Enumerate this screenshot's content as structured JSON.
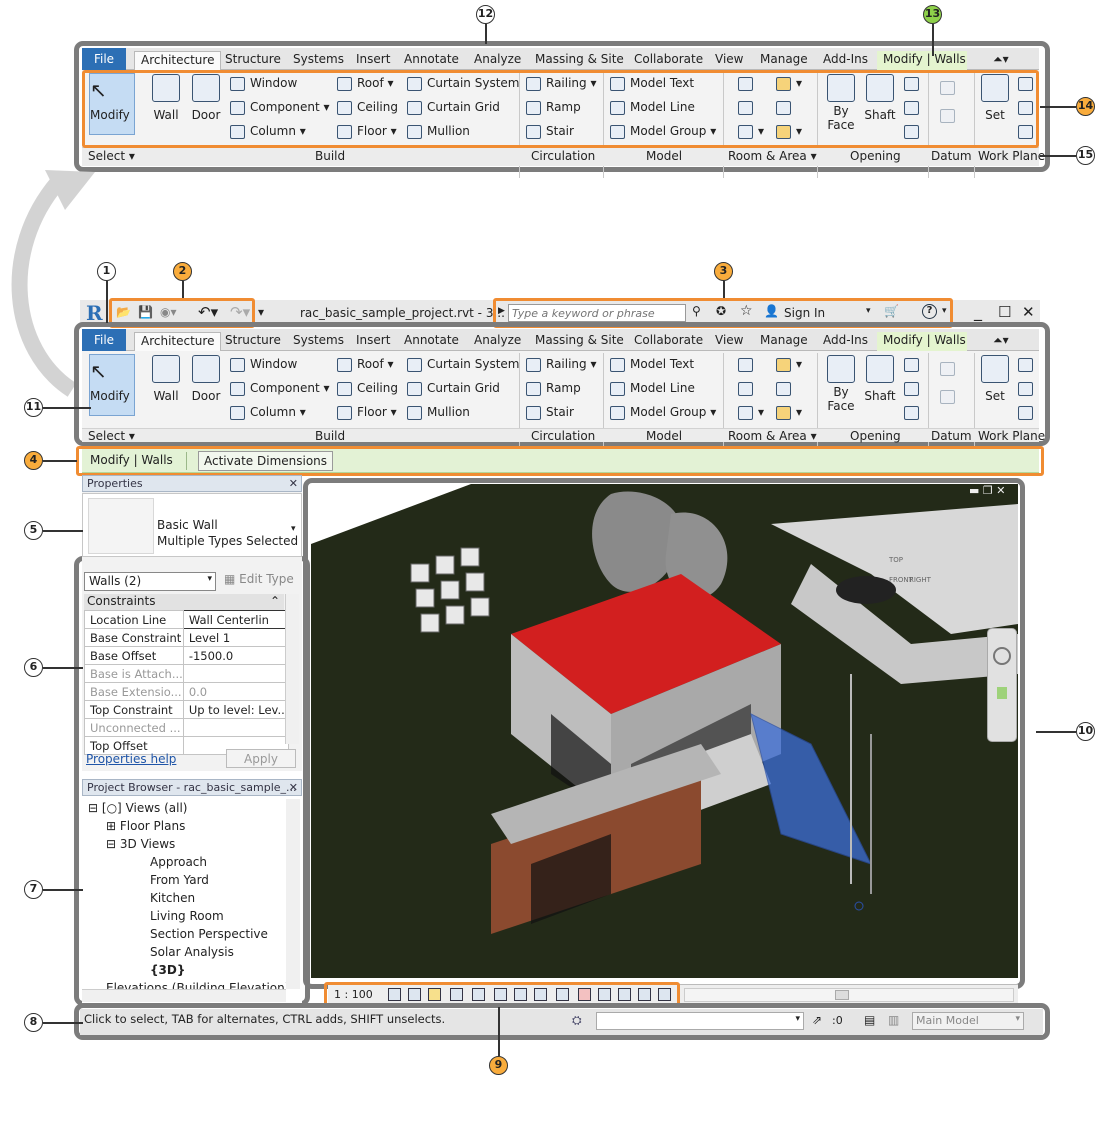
{
  "callouts": {
    "c1": "1",
    "c2": "2",
    "c3": "3",
    "c4": "4",
    "c5": "5",
    "c6": "6",
    "c7": "7",
    "c8": "8",
    "c9": "9",
    "c10": "10",
    "c11": "11",
    "c12": "12",
    "c13": "13",
    "c14": "14",
    "c15": "15"
  },
  "tabs": [
    "File",
    "Architecture",
    "Structure",
    "Systems",
    "Insert",
    "Annotate",
    "Analyze",
    "Massing & Site",
    "Collaborate",
    "View",
    "Manage",
    "Add-Ins",
    "Modify | Walls"
  ],
  "ribbon": {
    "modify": "Modify",
    "select": "Select",
    "wall": "Wall",
    "door": "Door",
    "window": "Window",
    "component": "Component",
    "column": "Column",
    "roof": "Roof",
    "ceiling": "Ceiling",
    "floor": "Floor",
    "curtain_system": "Curtain System",
    "curtain_grid": "Curtain Grid",
    "mullion": "Mullion",
    "railing": "Railing",
    "ramp": "Ramp",
    "stair": "Stair",
    "model_text": "Model Text",
    "model_line": "Model Line",
    "model_group": "Model Group",
    "by_face_1": "By",
    "by_face_2": "Face",
    "shaft": "Shaft",
    "set": "Set",
    "panels": {
      "build": "Build",
      "circulation": "Circulation",
      "model": "Model",
      "room_area": "Room & Area",
      "opening": "Opening",
      "datum": "Datum",
      "work_plane": "Work Plane"
    }
  },
  "titlebar": {
    "file": "rac_basic_sample_project.rvt - 3...",
    "search_placeholder": "Type a keyword or phrase",
    "sign_in": "Sign In"
  },
  "context_bar": {
    "label": "Modify | Walls",
    "button": "Activate Dimensions"
  },
  "properties": {
    "title": "Properties",
    "type_line1": "Basic Wall",
    "type_line2": "Multiple Types Selected",
    "selector": "Walls (2)",
    "edit_type": "Edit Type",
    "section": "Constraints",
    "rows": [
      [
        "Location Line",
        "Wall Centerlin"
      ],
      [
        "Base Constraint",
        "Level 1"
      ],
      [
        "Base Offset",
        "-1500.0"
      ],
      [
        "Base is Attach...",
        ""
      ],
      [
        "Base Extensio...",
        "0.0"
      ],
      [
        "Top Constraint",
        "Up to level: Lev..."
      ],
      [
        "Unconnected ...",
        ""
      ],
      [
        "Top Offset",
        ""
      ]
    ],
    "help": "Properties help",
    "apply": "Apply"
  },
  "project_browser": {
    "title": "Project Browser - rac_basic_sample_...",
    "items": [
      "Views (all)",
      "Floor Plans",
      "3D Views",
      "Approach",
      "From Yard",
      "Kitchen",
      "Living Room",
      "Section Perspective",
      "Solar Analysis",
      "{3D}",
      "Elevations (Building Elevation)"
    ]
  },
  "viewport": {
    "cube_top": "TOP",
    "cube_front": "FRONT",
    "cube_right": "RIGHT"
  },
  "view_control": {
    "scale": "1 : 100"
  },
  "status": {
    "message": "Click to select, TAB for alternates, CTRL adds, SHIFT unselects.",
    "count": ":0",
    "model": "Main Model"
  },
  "colors": {
    "accent_orange": "#f08c32",
    "frame_gray": "#7c7c7c",
    "file_tab": "#2c6fb5",
    "roof_red": "#d21f1f",
    "ground": "#232a18",
    "selection_blue": "#3d6fd8"
  }
}
